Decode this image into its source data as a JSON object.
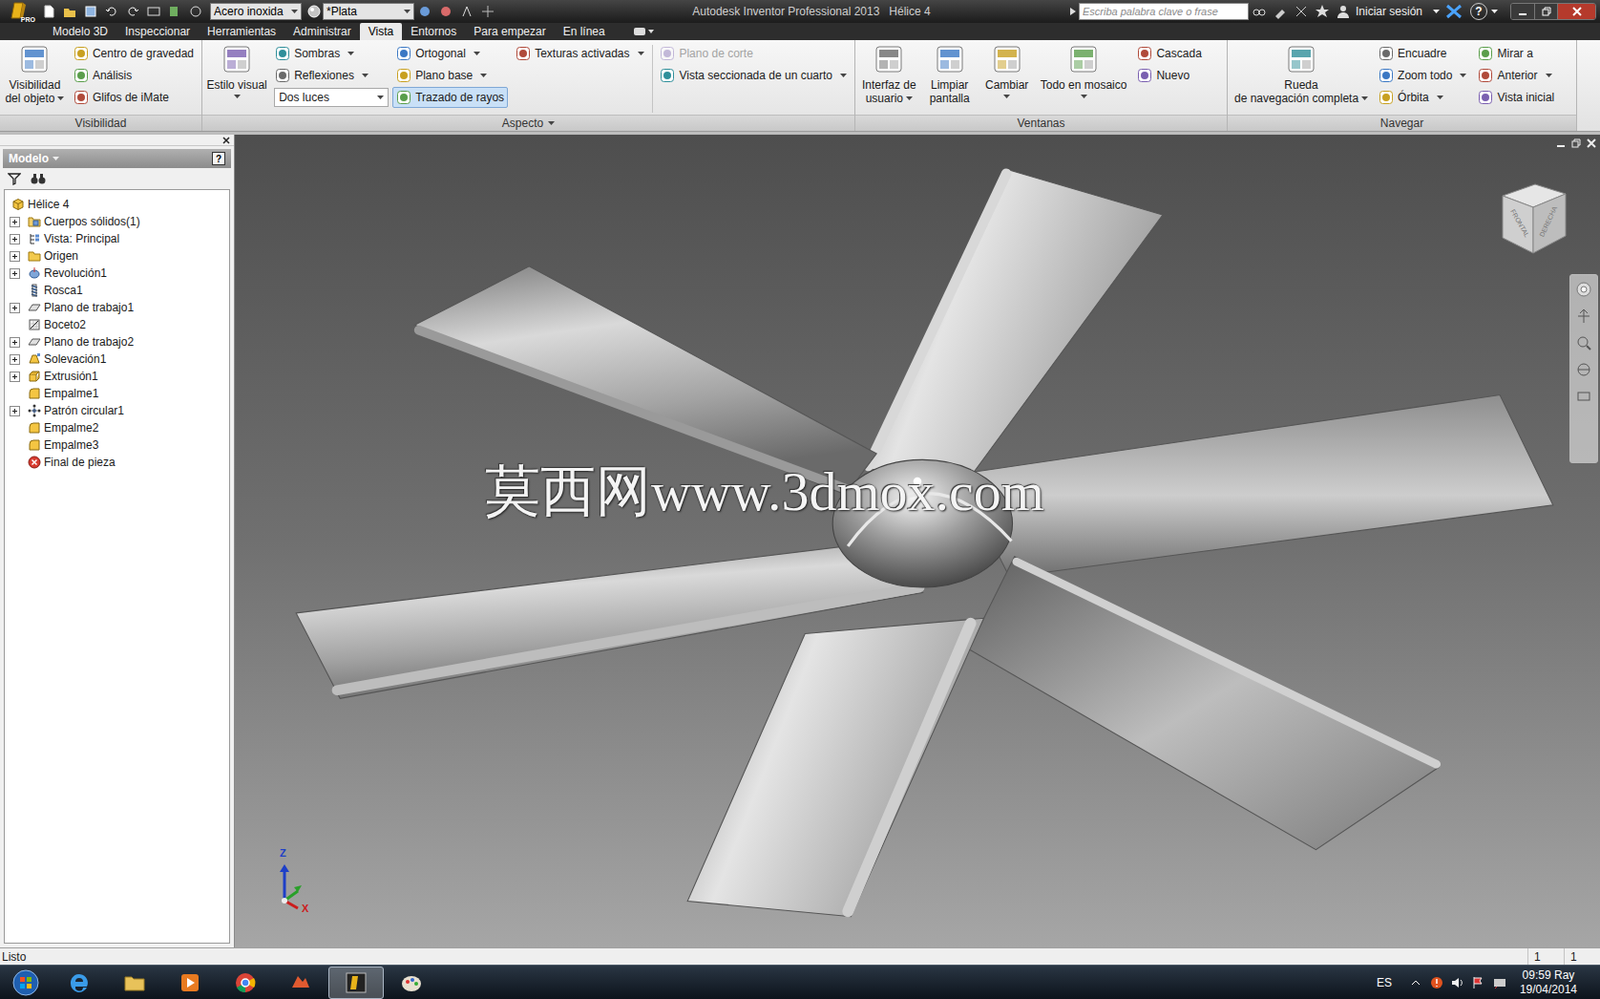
{
  "title_bar": {
    "app_badge": "PRO",
    "material": "Acero inoxida",
    "appearance": "*Plata",
    "app_title": "Autodesk Inventor Professional 2013",
    "document": "Hélice 4",
    "search_placeholder": "Escriba palabra clave o frase",
    "sign_in": "Iniciar sesión",
    "help": "?"
  },
  "tabs": [
    {
      "label": "Modelo 3D",
      "selected": false
    },
    {
      "label": "Inspeccionar",
      "selected": false
    },
    {
      "label": "Herramientas",
      "selected": false
    },
    {
      "label": "Administrar",
      "selected": false
    },
    {
      "label": "Vista",
      "selected": true
    },
    {
      "label": "Entornos",
      "selected": false
    },
    {
      "label": "Para empezar",
      "selected": false
    },
    {
      "label": "En línea",
      "selected": false
    }
  ],
  "ribbon": {
    "groups": [
      {
        "label": "Visibilidad",
        "has_menu": false,
        "columns": [
          {
            "kind": "large",
            "divider": false,
            "items": [
              {
                "lines": [
                  "Visibilidad",
                  "del objeto"
                ],
                "has_menu": true,
                "selected": false,
                "disabled": false
              }
            ]
          },
          {
            "kind": "stack",
            "divider": false,
            "items": [
              {
                "label": "Centro de gravedad",
                "kind": "button",
                "has_menu": false,
                "selected": false,
                "disabled": false
              },
              {
                "label": "Análisis",
                "kind": "button",
                "has_menu": false,
                "selected": false,
                "disabled": false
              },
              {
                "label": "Glifos de iMate",
                "kind": "button",
                "has_menu": false,
                "selected": false,
                "disabled": false
              }
            ]
          }
        ]
      },
      {
        "label": "Aspecto",
        "has_menu": true,
        "columns": [
          {
            "kind": "large",
            "divider": false,
            "items": [
              {
                "lines": [
                  "Estilo visual"
                ],
                "has_menu": true,
                "selected": false,
                "disabled": false
              }
            ]
          },
          {
            "kind": "stack",
            "divider": false,
            "items": [
              {
                "label": "Sombras",
                "kind": "button",
                "has_menu": true,
                "selected": false,
                "disabled": false
              },
              {
                "label": "Reflexiones",
                "kind": "button",
                "has_menu": true,
                "selected": false,
                "disabled": false
              },
              {
                "label": "Dos luces",
                "kind": "combo",
                "has_menu": true,
                "selected": false,
                "disabled": false
              }
            ]
          },
          {
            "kind": "stack",
            "divider": false,
            "items": [
              {
                "label": "Ortogonal",
                "kind": "button",
                "has_menu": true,
                "selected": false,
                "disabled": false
              },
              {
                "label": "Plano base",
                "kind": "button",
                "has_menu": true,
                "selected": false,
                "disabled": false
              },
              {
                "label": "Trazado de rayos",
                "kind": "button",
                "has_menu": false,
                "selected": true,
                "disabled": false
              }
            ]
          },
          {
            "kind": "stack",
            "divider": false,
            "items": [
              {
                "label": "Texturas activadas",
                "kind": "button",
                "has_menu": true,
                "selected": false,
                "disabled": false
              }
            ]
          },
          {
            "kind": "stack",
            "divider": true,
            "items": [
              {
                "label": "Plano de corte",
                "kind": "button",
                "has_menu": false,
                "selected": false,
                "disabled": true
              },
              {
                "label": "Vista seccionada de un cuarto",
                "kind": "button",
                "has_menu": true,
                "selected": false,
                "disabled": false
              }
            ]
          }
        ]
      },
      {
        "label": "Ventanas",
        "has_menu": false,
        "columns": [
          {
            "kind": "large",
            "divider": false,
            "items": [
              {
                "lines": [
                  "Interfaz de",
                  "usuario"
                ],
                "has_menu": true,
                "selected": false,
                "disabled": false
              },
              {
                "lines": [
                  "Limpiar",
                  "pantalla"
                ],
                "has_menu": false,
                "selected": false,
                "disabled": false
              },
              {
                "lines": [
                  "Cambiar"
                ],
                "has_menu": true,
                "selected": false,
                "disabled": false
              },
              {
                "lines": [
                  "Todo en mosaico"
                ],
                "has_menu": true,
                "selected": false,
                "disabled": false
              }
            ]
          },
          {
            "kind": "stack",
            "divider": false,
            "items": [
              {
                "label": "Cascada",
                "kind": "button",
                "has_menu": false,
                "selected": false,
                "disabled": false
              },
              {
                "label": "Nuevo",
                "kind": "button",
                "has_menu": false,
                "selected": false,
                "disabled": false
              }
            ]
          }
        ]
      },
      {
        "label": "Navegar",
        "has_menu": false,
        "columns": [
          {
            "kind": "large",
            "divider": false,
            "items": [
              {
                "lines": [
                  "Rueda",
                  "de navegación completa"
                ],
                "has_menu": true,
                "selected": false,
                "disabled": false
              }
            ]
          },
          {
            "kind": "stack",
            "divider": false,
            "items": [
              {
                "label": "Encuadre",
                "kind": "button",
                "has_menu": false,
                "selected": false,
                "disabled": false
              },
              {
                "label": "Zoom todo",
                "kind": "button",
                "has_menu": true,
                "selected": false,
                "disabled": false
              },
              {
                "label": "Órbita",
                "kind": "button",
                "has_menu": true,
                "selected": false,
                "disabled": false
              }
            ]
          },
          {
            "kind": "stack",
            "divider": false,
            "items": [
              {
                "label": "Mirar a",
                "kind": "button",
                "has_menu": false,
                "selected": false,
                "disabled": false
              },
              {
                "label": "Anterior",
                "kind": "button",
                "has_menu": true,
                "selected": false,
                "disabled": false
              },
              {
                "label": "Vista inicial",
                "kind": "button",
                "has_menu": false,
                "selected": false,
                "disabled": false
              }
            ]
          }
        ]
      }
    ]
  },
  "browser": {
    "title": "Modelo",
    "help": "?",
    "root": {
      "label": "Hélice 4"
    },
    "items": [
      {
        "label": "Cuerpos sólidos(1)",
        "kind": "solids",
        "expandable": true,
        "expanded": false
      },
      {
        "label": "Vista: Principal",
        "kind": "view",
        "expandable": true,
        "expanded": false
      },
      {
        "label": "Origen",
        "kind": "folder",
        "expandable": true,
        "expanded": false
      },
      {
        "label": "Revolución1",
        "kind": "revolve",
        "expandable": true,
        "expanded": false
      },
      {
        "label": "Rosca1",
        "kind": "thread",
        "expandable": false,
        "expanded": false
      },
      {
        "label": "Plano de trabajo1",
        "kind": "workplane",
        "expandable": true,
        "expanded": false
      },
      {
        "label": "Boceto2",
        "kind": "sketch",
        "expandable": false,
        "expanded": false
      },
      {
        "label": "Plano de trabajo2",
        "kind": "workplane",
        "expandable": true,
        "expanded": false
      },
      {
        "label": "Solevación1",
        "kind": "loft",
        "expandable": true,
        "expanded": false
      },
      {
        "label": "Extrusión1",
        "kind": "extrude",
        "expandable": true,
        "expanded": false
      },
      {
        "label": "Empalme1",
        "kind": "fillet",
        "expandable": false,
        "expanded": false
      },
      {
        "label": "Patrón circular1",
        "kind": "pattern",
        "expandable": true,
        "expanded": false
      },
      {
        "label": "Empalme2",
        "kind": "fillet",
        "expandable": false,
        "expanded": false
      },
      {
        "label": "Empalme3",
        "kind": "fillet",
        "expandable": false,
        "expanded": false
      },
      {
        "label": "Final de pieza",
        "kind": "end",
        "expandable": false,
        "expanded": false
      }
    ]
  },
  "viewport": {
    "watermark": "莫西网www.3dmox.com",
    "viewcube": {
      "front": "FRONTAL",
      "right": "DERECHA"
    },
    "axes": {
      "z": "Z",
      "x": "X"
    }
  },
  "status_bar": {
    "text": "Listo",
    "fields": [
      "1",
      "1"
    ]
  },
  "taskbar": {
    "apps": [
      {
        "kind": "ie",
        "selected": false
      },
      {
        "kind": "explorer",
        "selected": false
      },
      {
        "kind": "media",
        "selected": false
      },
      {
        "kind": "chrome",
        "selected": false
      },
      {
        "kind": "app",
        "selected": false
      },
      {
        "kind": "inventor",
        "selected": true
      },
      {
        "kind": "paint",
        "selected": false
      }
    ],
    "language": "ES",
    "time": "09:59 Ray",
    "date": "19/04/2014"
  }
}
